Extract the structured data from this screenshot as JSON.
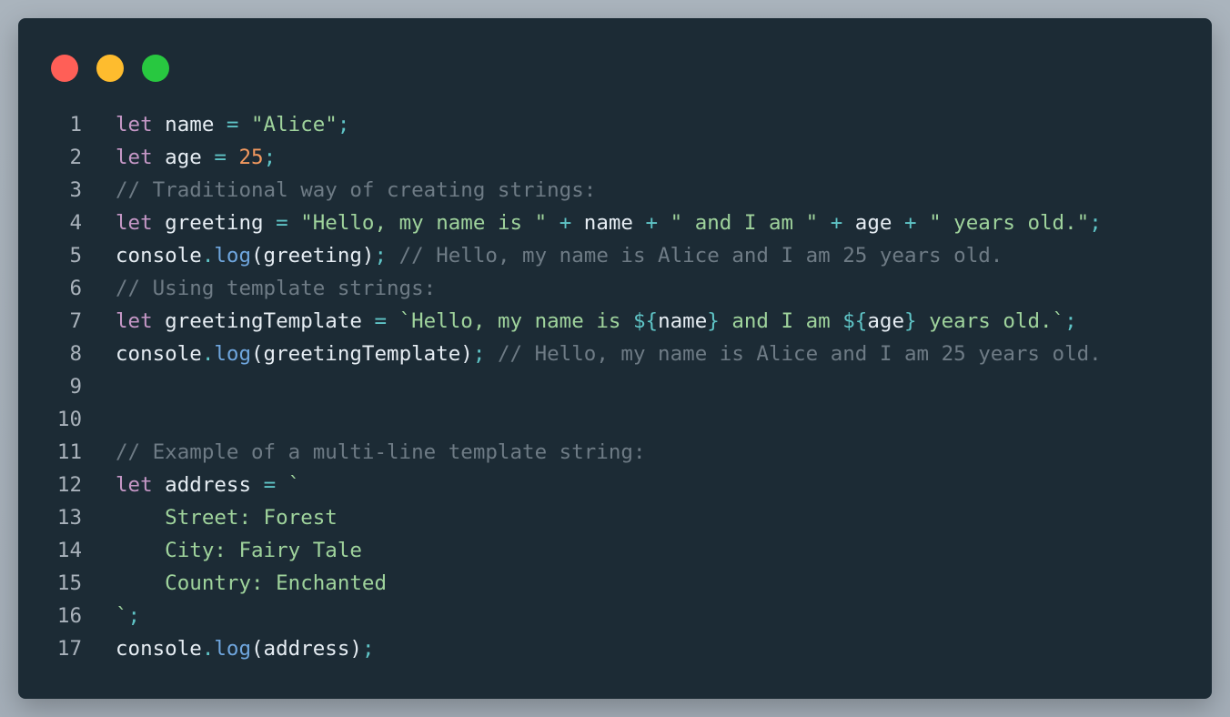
{
  "window": {
    "controls": [
      {
        "name": "close",
        "color": "#ff5f57"
      },
      {
        "name": "minimize",
        "color": "#febc2e"
      },
      {
        "name": "maximize",
        "color": "#28c840"
      }
    ]
  },
  "code": {
    "lines": [
      {
        "n": "1",
        "tokens": [
          [
            "kw",
            "let"
          ],
          [
            "id",
            " name "
          ],
          [
            "op",
            "="
          ],
          [
            "id",
            " "
          ],
          [
            "str",
            "\"Alice\""
          ],
          [
            "op",
            ";"
          ]
        ]
      },
      {
        "n": "2",
        "tokens": [
          [
            "kw",
            "let"
          ],
          [
            "id",
            " age "
          ],
          [
            "op",
            "="
          ],
          [
            "id",
            " "
          ],
          [
            "num",
            "25"
          ],
          [
            "op",
            ";"
          ]
        ]
      },
      {
        "n": "3",
        "tokens": [
          [
            "cm",
            "// Traditional way of creating strings:"
          ]
        ]
      },
      {
        "n": "4",
        "tokens": [
          [
            "kw",
            "let"
          ],
          [
            "id",
            " greeting "
          ],
          [
            "op",
            "="
          ],
          [
            "id",
            " "
          ],
          [
            "str",
            "\"Hello, my name is \""
          ],
          [
            "id",
            " "
          ],
          [
            "op",
            "+"
          ],
          [
            "id",
            " name "
          ],
          [
            "op",
            "+"
          ],
          [
            "id",
            " "
          ],
          [
            "str",
            "\" and I am \""
          ],
          [
            "id",
            " "
          ],
          [
            "op",
            "+"
          ],
          [
            "id",
            " age "
          ],
          [
            "op",
            "+"
          ],
          [
            "id",
            " "
          ],
          [
            "str",
            "\" years old.\""
          ],
          [
            "op",
            ";"
          ]
        ]
      },
      {
        "n": "5",
        "tokens": [
          [
            "id",
            "console"
          ],
          [
            "op",
            "."
          ],
          [
            "fn",
            "log"
          ],
          [
            "pun",
            "(greeting)"
          ],
          [
            "op",
            ";"
          ],
          [
            "id",
            " "
          ],
          [
            "cm",
            "// Hello, my name is Alice and I am 25 years old."
          ]
        ]
      },
      {
        "n": "6",
        "tokens": [
          [
            "cm",
            "// Using template strings:"
          ]
        ]
      },
      {
        "n": "7",
        "tokens": [
          [
            "kw",
            "let"
          ],
          [
            "id",
            " greetingTemplate "
          ],
          [
            "op",
            "="
          ],
          [
            "id",
            " "
          ],
          [
            "str",
            "`Hello, my name is "
          ],
          [
            "op",
            "${"
          ],
          [
            "id",
            "name"
          ],
          [
            "op",
            "}"
          ],
          [
            "str",
            " and I am "
          ],
          [
            "op",
            "${"
          ],
          [
            "id",
            "age"
          ],
          [
            "op",
            "}"
          ],
          [
            "str",
            " years old.`"
          ],
          [
            "op",
            ";"
          ]
        ]
      },
      {
        "n": "8",
        "tokens": [
          [
            "id",
            "console"
          ],
          [
            "op",
            "."
          ],
          [
            "fn",
            "log"
          ],
          [
            "pun",
            "(greetingTemplate)"
          ],
          [
            "op",
            ";"
          ],
          [
            "id",
            " "
          ],
          [
            "cm",
            "// Hello, my name is Alice and I am 25 years old."
          ]
        ]
      },
      {
        "n": "9",
        "tokens": []
      },
      {
        "n": "10",
        "tokens": []
      },
      {
        "n": "11",
        "tokens": [
          [
            "cm",
            "// Example of a multi-line template string:"
          ]
        ]
      },
      {
        "n": "12",
        "tokens": [
          [
            "kw",
            "let"
          ],
          [
            "id",
            " address "
          ],
          [
            "op",
            "="
          ],
          [
            "id",
            " "
          ],
          [
            "str",
            "`"
          ]
        ]
      },
      {
        "n": "13",
        "tokens": [
          [
            "str",
            "    Street: Forest"
          ]
        ]
      },
      {
        "n": "14",
        "tokens": [
          [
            "str",
            "    City: Fairy Tale"
          ]
        ]
      },
      {
        "n": "15",
        "tokens": [
          [
            "str",
            "    Country: Enchanted"
          ]
        ]
      },
      {
        "n": "16",
        "tokens": [
          [
            "str",
            "`"
          ],
          [
            "op",
            ";"
          ]
        ]
      },
      {
        "n": "17",
        "tokens": [
          [
            "id",
            "console"
          ],
          [
            "op",
            "."
          ],
          [
            "fn",
            "log"
          ],
          [
            "pun",
            "(address)"
          ],
          [
            "op",
            ";"
          ]
        ]
      }
    ]
  }
}
